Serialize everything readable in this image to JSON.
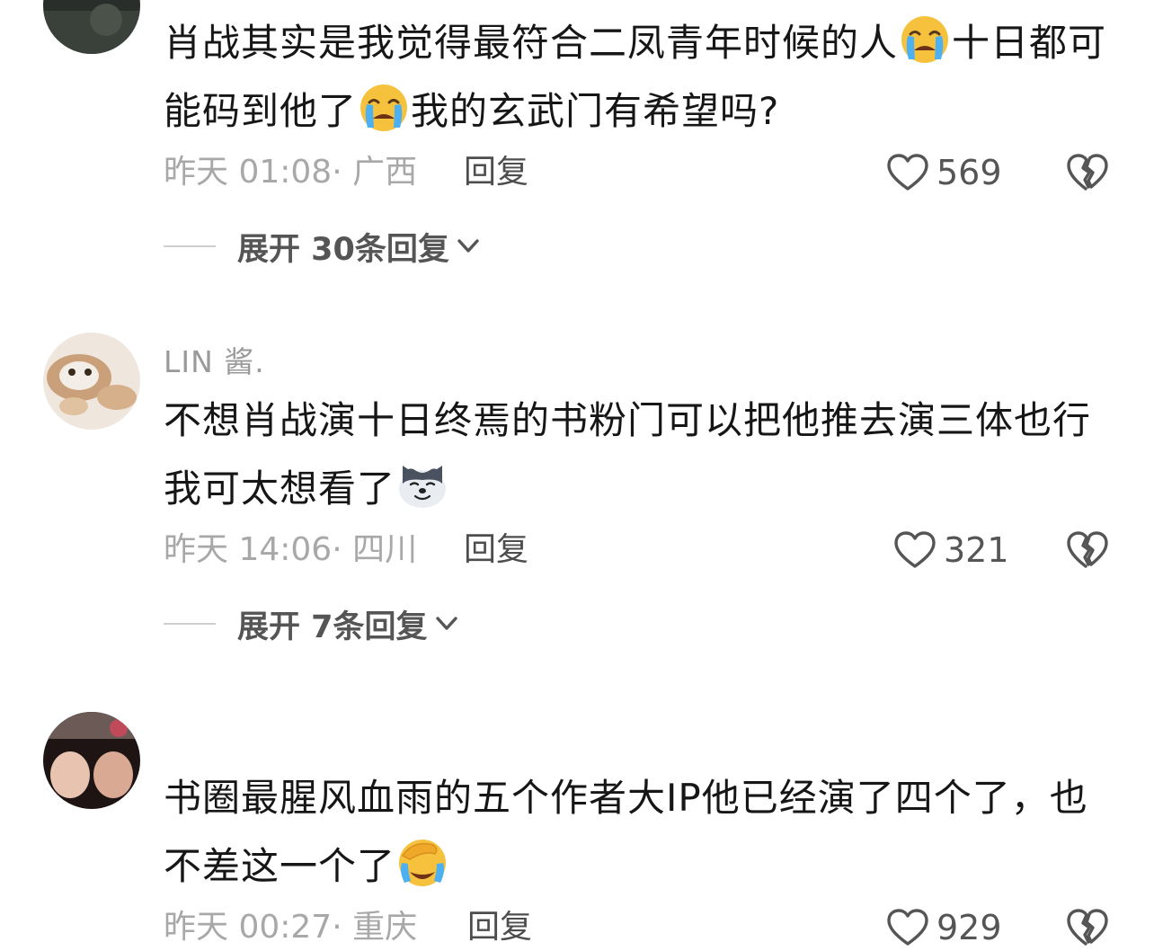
{
  "comments": [
    {
      "username": "",
      "content_part1": "肖战其实是我觉得最符合二凤青年时候的人",
      "content_part2": "十日都可能码到他了",
      "content_part3": "我的玄武门有希望吗?",
      "emoji": "loudly-crying-face",
      "time": "昨天 01:08",
      "location": "· 广西",
      "reply_label": "回复",
      "likes": "569",
      "expand_label": "展开 30条回复"
    },
    {
      "username": "LIN 酱.",
      "content_part1": "不想肖战演十日终焉的书粉门可以把他推去演三体也行 我可太想看了",
      "emoji": "husky-doge-face",
      "time": "昨天 14:06",
      "location": "· 四川",
      "reply_label": "回复",
      "likes": "321",
      "expand_label": "展开 7条回复"
    },
    {
      "username": "",
      "content_part1": "书圈最腥风血雨的五个作者大IP他已经演了四个了，也不差这一个了",
      "emoji": "face-palm-crying",
      "time": "昨天 00:27",
      "location": "· 重庆",
      "reply_label": "回复",
      "likes": "929"
    }
  ],
  "icons": {
    "like": "heart-outline-icon",
    "dislike": "broken-heart-icon",
    "expand": "chevron-down-icon"
  },
  "colors": {
    "text": "#161616",
    "meta": "#a8a8a8",
    "reply": "#4d4d4d",
    "emoji_yellow": "#f6c23e"
  }
}
